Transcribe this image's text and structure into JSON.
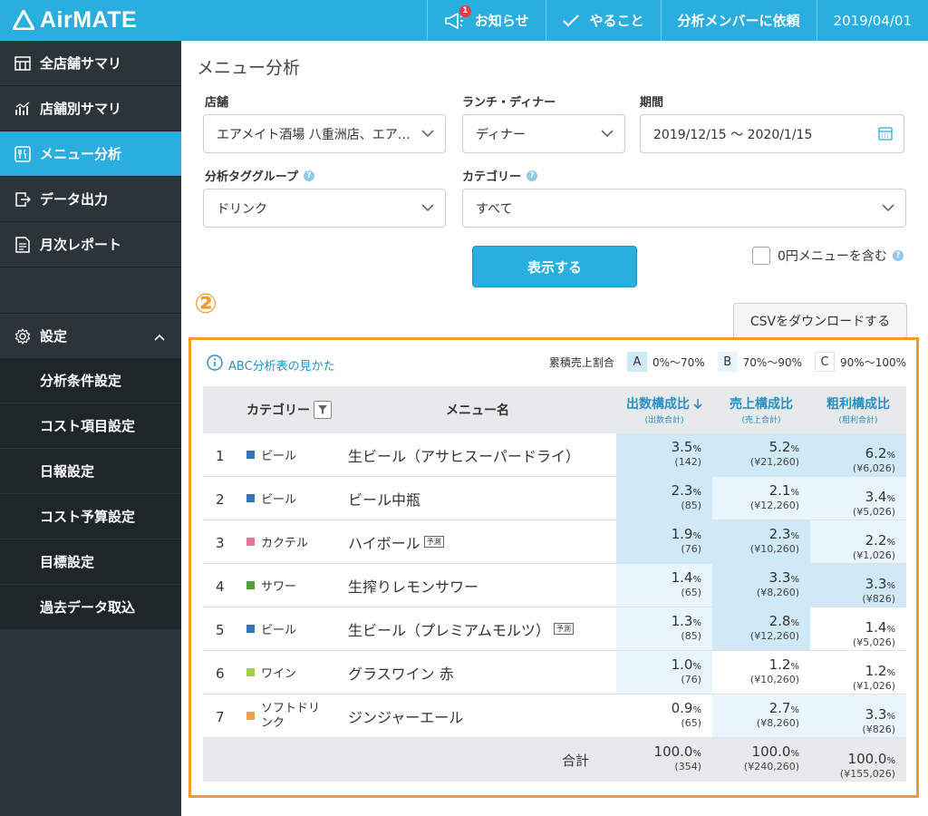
{
  "header": {
    "logo": "AirMATE",
    "notifications_badge": "1",
    "nav": {
      "notice": "お知らせ",
      "todo": "やること",
      "request": "分析メンバーに依頼",
      "date": "2019/04/01"
    }
  },
  "sidebar": {
    "items": [
      {
        "label": "全店舗サマリ",
        "icon": "store-icon"
      },
      {
        "label": "店舗別サマリ",
        "icon": "chart-icon"
      },
      {
        "label": "メニュー分析",
        "icon": "menu-icon"
      },
      {
        "label": "データ出力",
        "icon": "export-icon"
      },
      {
        "label": "月次レポート",
        "icon": "report-icon"
      }
    ],
    "settings": "設定",
    "sub_items": [
      "分析条件設定",
      "コスト項目設定",
      "日報設定",
      "コスト予算設定",
      "目標設定",
      "過去データ取込"
    ]
  },
  "page": {
    "title": "メニュー分析",
    "filters": {
      "store_label": "店舗",
      "store_value": "エアメイト酒場 八重洲店、エア…",
      "lunch_label": "ランチ・ディナー",
      "lunch_value": "ディナー",
      "period_label": "期間",
      "period_value": "2019/12/15 〜 2020/1/15",
      "tag_label": "分析タググループ",
      "tag_value": "ドリンク",
      "category_label": "カテゴリー",
      "category_value": "すべて"
    },
    "show_button": "表示する",
    "zero_menu_label": "0円メニューを含む",
    "marker": "②",
    "csv_button": "CSVをダウンロードする"
  },
  "abc": {
    "howto": "ABC分析表の見かた",
    "legend_label": "累積売上割合",
    "legend": [
      {
        "key": "A",
        "range": "0%〜70%",
        "color": "#cfe9f7"
      },
      {
        "key": "B",
        "range": "70%〜90%",
        "color": "#e9f5fc"
      },
      {
        "key": "C",
        "range": "90%〜100%",
        "color": "#ffffff"
      }
    ]
  },
  "table": {
    "headers": {
      "category": "カテゴリー",
      "menu": "メニュー名",
      "count": "出数構成比",
      "count_sub": "(出数合計)",
      "sales": "売上構成比",
      "sales_sub": "(売上合計)",
      "profit": "粗利構成比",
      "profit_sub": "(粗利合計)"
    },
    "rows": [
      {
        "no": "1",
        "category": "ビール",
        "color": "#2e77b3",
        "menu": "生ビール（アサヒスーパードライ）",
        "forecast": "",
        "count_pct": "3.5",
        "count": "(142)",
        "count_rank": "A",
        "sales_pct": "5.2",
        "sales": "(¥21,260)",
        "sales_rank": "A",
        "profit_pct": "6.2",
        "profit": "(¥6,026)",
        "profit_rank": "A"
      },
      {
        "no": "2",
        "category": "ビール",
        "color": "#2e77b3",
        "menu": "ビール中瓶",
        "forecast": "",
        "count_pct": "2.3",
        "count": "(85)",
        "count_rank": "A",
        "sales_pct": "2.1",
        "sales": "(¥12,260)",
        "sales_rank": "B",
        "profit_pct": "3.4",
        "profit": "(¥5,026)",
        "profit_rank": "B"
      },
      {
        "no": "3",
        "category": "カクテル",
        "color": "#e6749c",
        "menu": "ハイボール",
        "forecast": "予測",
        "count_pct": "1.9",
        "count": "(76)",
        "count_rank": "A",
        "sales_pct": "2.3",
        "sales": "(¥10,260)",
        "sales_rank": "A",
        "profit_pct": "2.2",
        "profit": "(¥1,026)",
        "profit_rank": "B"
      },
      {
        "no": "4",
        "category": "サワー",
        "color": "#4fa135",
        "menu": "生搾りレモンサワー",
        "forecast": "",
        "count_pct": "1.4",
        "count": "(65)",
        "count_rank": "B",
        "sales_pct": "3.3",
        "sales": "(¥8,260)",
        "sales_rank": "A",
        "profit_pct": "3.3",
        "profit": "(¥826)",
        "profit_rank": "A"
      },
      {
        "no": "5",
        "category": "ビール",
        "color": "#2e77b3",
        "menu": "生ビール（プレミアムモルツ）",
        "forecast": "予測",
        "count_pct": "1.3",
        "count": "(85)",
        "count_rank": "B",
        "sales_pct": "2.8",
        "sales": "(¥12,260)",
        "sales_rank": "A",
        "profit_pct": "1.4",
        "profit": "(¥5,026)",
        "profit_rank": "C"
      },
      {
        "no": "6",
        "category": "ワイン",
        "color": "#9ed04b",
        "menu": "グラスワイン 赤",
        "forecast": "",
        "count_pct": "1.0",
        "count": "(76)",
        "count_rank": "B",
        "sales_pct": "1.2",
        "sales": "(¥10,260)",
        "sales_rank": "C",
        "profit_pct": "1.2",
        "profit": "(¥1,026)",
        "profit_rank": "C"
      },
      {
        "no": "7",
        "category": "ソフトドリンク",
        "color": "#f0a04b",
        "menu": "ジンジャーエール",
        "forecast": "",
        "count_pct": "0.9",
        "count": "(65)",
        "count_rank": "C",
        "sales_pct": "2.7",
        "sales": "(¥8,260)",
        "sales_rank": "B",
        "profit_pct": "3.3",
        "profit": "(¥826)",
        "profit_rank": "B"
      }
    ],
    "pct_unit": "%",
    "total": {
      "label": "合計",
      "count_pct": "100.0",
      "count": "(354)",
      "sales_pct": "100.0",
      "sales": "(¥240,260)",
      "profit_pct": "100.0",
      "profit": "(¥155,026)"
    }
  }
}
